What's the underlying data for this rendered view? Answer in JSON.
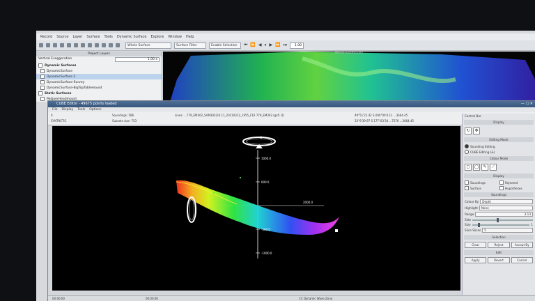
{
  "app": {
    "menu": [
      "Record",
      "Source",
      "Layer",
      "Surface",
      "Tools",
      "Dynamic Surface",
      "Explore",
      "Window",
      "Help"
    ],
    "toolbar": {
      "selector1": "Whole Surface",
      "selector2": "Surface Filter",
      "selector3": "Enable Selection",
      "playback_value": "1.00"
    }
  },
  "layers_panel": {
    "title": "Project Layers",
    "vertical_exaggeration_label": "Vertical Exaggeration",
    "vertical_exaggeration_value": "1.00 x",
    "groups": [
      {
        "label": "Dynamic Surfaces",
        "items": [
          "DynamicSurface",
          "DynamicSurface 2",
          "DynamicSurface-Survey",
          "DynamicSurface-BigTopTablemount"
        ]
      },
      {
        "label": "Static Surfaces",
        "items": [
          "PedjoerHeadmount"
        ]
      }
    ]
  },
  "background_view": {
    "title": "Whole Seamounts"
  },
  "editor": {
    "title": "CUBE Editor - 49675 points loaded",
    "menu": [
      "File",
      "Display",
      "Tools",
      "Options"
    ],
    "info": {
      "left_top": "0",
      "left_bottom": "SYNTHETIC",
      "soundings": "Soundings: 586",
      "subsets": "Subsets size: 753",
      "lines": "Lines: ...779_EM302_SAM302(20.11_20110312_1955_F16 779_EM302 (gsf) (1)",
      "pos1": "49°51'21.42 S 000°00'4.11 ...3664.45",
      "pos2": "33°9'39.97 S 177°03'34 ...7576 ...3664.45"
    },
    "status": {
      "left": "00:00:00",
      "mid": "00:00:00",
      "right": "CC Dynamic Wave Zone"
    }
  },
  "view3d": {
    "axis_labels": {
      "top": "1000.0",
      "upper": "600.0",
      "mid": "2000.0",
      "lower": "-500.0",
      "bottom": "-1000.0"
    },
    "north_label": "N"
  },
  "control_bar": {
    "title": "Control Bar",
    "display_header": "Display",
    "edit_header": "Editing Mode",
    "sounding_editing": "Sounding Editing",
    "cube_editing": "CUBE Editing (&)",
    "color_header": "Colour Mode",
    "display2_header": "Display",
    "soundings": "Soundings",
    "rejected": "Rejected",
    "surface": "Surface",
    "hypotheses": "Hypotheses",
    "soundings_header": "Soundings",
    "color_by_label": "Colour By",
    "color_by_value": "Depth",
    "highlight_label": "Highlight",
    "highlight_value": "None",
    "range_label": "Range",
    "range_value": "3.13",
    "size_label": "Size",
    "size_value": "1",
    "side_label": "Side",
    "size_slices_label": "Slice Slices",
    "size_slices_value": "5",
    "selection_header": "Selection",
    "btn_clear": "Clear",
    "btn_reject": "Reject",
    "btn_accept": "Accept By",
    "edit_header2": "Edit",
    "btn_apply": "Apply",
    "btn_revert": "Revert",
    "btn_cancel": "Cancel"
  },
  "colors": {
    "accent": "#3f6390",
    "plot_bg": "#000000"
  }
}
